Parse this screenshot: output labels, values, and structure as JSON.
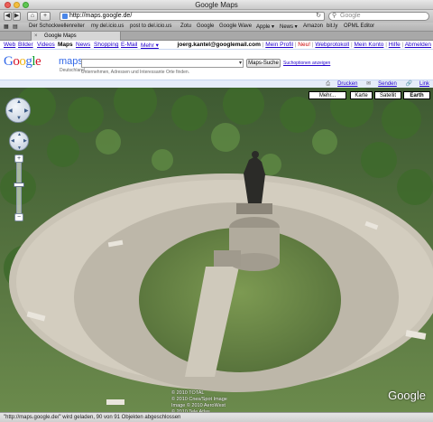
{
  "window": {
    "title": "Google Maps"
  },
  "toolbar": {
    "url": "http://maps.google.de/",
    "search_placeholder": "Google"
  },
  "bookmarks": [
    "Der Schockwellenreiter",
    "my del.icio.us",
    "post to del.icio.us",
    "Zotu",
    "Google",
    "Google Wave",
    "Apple ▾",
    "News ▾",
    "Amazon",
    "bit.ly",
    "OPML Editor"
  ],
  "tab": {
    "label": "Google Maps"
  },
  "gnav": {
    "left": [
      "Web",
      "Bilder",
      "Videos",
      "Maps",
      "News",
      "Shopping",
      "E-Mail",
      "Mehr ▾"
    ],
    "active": "Maps",
    "user": "joerg.kantel@googlemail.com",
    "links": [
      "Mein Profil",
      "Neu!",
      "Webprotokoll",
      "Mein Konto",
      "Hilfe",
      "Abmelden"
    ]
  },
  "header": {
    "logo": "Google",
    "maps_word": "maps",
    "country": "Deutschland",
    "hint": "Unternehmen, Adressen und Interessante Orte finden.",
    "search_button": "Maps-Suche",
    "options_link": "Suchoptionen anzeigen"
  },
  "actions": {
    "print": "Drucken",
    "send": "Senden",
    "link": "Link"
  },
  "map_types": [
    "Mehr...",
    "Karte",
    "Satellit",
    "Earth"
  ],
  "map_type_active": "Earth",
  "copyright": [
    "© 2010 TOTAL",
    "© 2010 Cnes/Spot Image",
    "Image © 2010 AeroWest",
    "© 2010 Tele Atlas"
  ],
  "map_logo": "Google",
  "status": "\"http://maps.google.de/\" wird geladen, 90 von 91 Objekten abgeschlossen",
  "colors": {
    "link": "#2200cc",
    "bluebar": "#e5ecf9",
    "neu": "#cc0000"
  }
}
